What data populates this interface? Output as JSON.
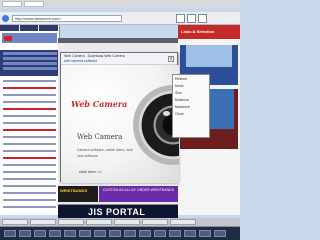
{
  "browser": {
    "address_url": "http://www.bestvmm.com/"
  },
  "popup": {
    "title": "Web Camera - Download Web Camera",
    "subtitle": "web camera software",
    "logo": "Web Camera",
    "heading": "Web Camera",
    "description": "Camera software, online video, web cam software",
    "more": "click here >>",
    "close": "x"
  },
  "context_menu": {
    "items": [
      "Restore",
      "Move",
      "Size",
      "Minimize",
      "Maximize",
      "Close"
    ]
  },
  "right_page": {
    "header": "Links & Selection"
  },
  "ads": {
    "wristbands": "WRISTBANDS",
    "custom": "CUSTOM AS ALL BY ORDER WRISTBANDS",
    "portal": "JIS PORTAL"
  }
}
